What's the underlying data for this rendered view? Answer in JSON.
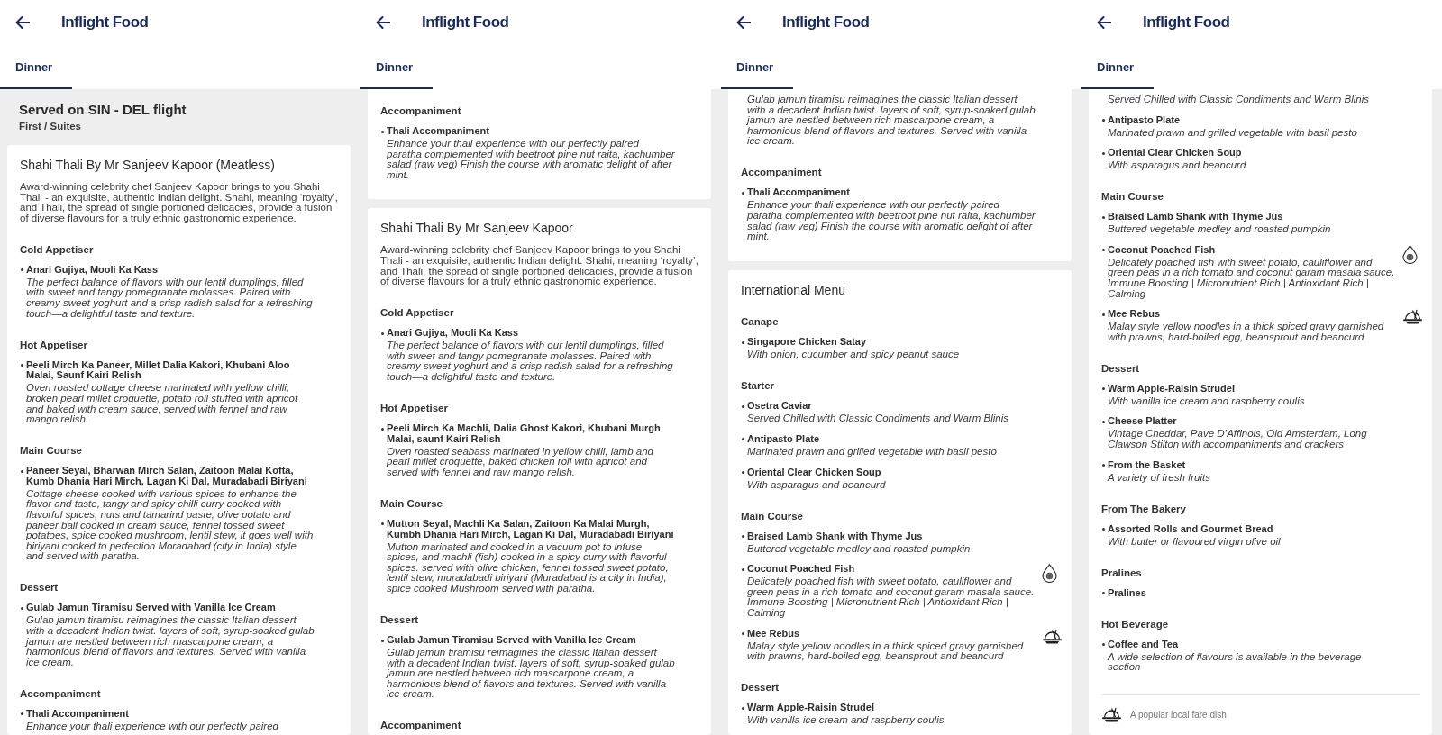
{
  "screens": [
    {
      "header": {
        "title": "Inflight Food"
      },
      "tabs": [
        {
          "label": "Dinner",
          "selected": true
        }
      ],
      "flight": {
        "route": "Served on SIN - DEL flight",
        "cabin": "First / Suites"
      },
      "cards": [
        {
          "title": "Shahi Thali By Mr Sanjeev Kapoor (Meatless)",
          "description": "Award-winning celebrity chef Sanjeev Kapoor brings to you Shahi Thali - an exquisite, authentic Indian delight. Shahi, meaning ‘royalty’, and Thali, the spread of single portioned delicacies, provide a fusion of diverse flavours for a truly ethnic gastronomic experience.",
          "sections": [
            {
              "heading": "Cold Appetiser",
              "items": [
                {
                  "name": "Anari Gujiya, Mooli Ka Kass",
                  "description": "The perfect balance of flavors with our lentil dumplings, filled with sweet and tangy pomegranate molasses. Paired with creamy sweet yoghurt and a crisp radish salad for a refreshing touch—a delightful taste and texture."
                }
              ]
            },
            {
              "heading": "Hot Appetiser",
              "items": [
                {
                  "name": "Peeli Mirch Ka Paneer, Millet Dalia Kakori, Khubani Aloo Malai, Saunf Kairi Relish",
                  "description": "Oven roasted cottage cheese marinated with yellow chilli, broken pearl millet croquette, potato roll stuffed with apricot and baked with cream sauce, served with fennel and raw mango relish."
                }
              ]
            },
            {
              "heading": "Main Course",
              "items": [
                {
                  "name": "Paneer Seyal, Bharwan Mirch Salan, Zaitoon Malai Kofta, Kumb Dhania Hari Mirch, Lagan Ki Dal, Muradabadi Biriyani",
                  "description": "Cottage cheese cooked with various spices to enhance the flavor and taste, tangy and spicy chilli curry cooked with flavorful spices, nuts and tamarind paste, olive potato and paneer ball cooked in cream sauce, fennel tossed sweet potatoes, spice cooked mushroom, lentil stew, it goes well with biriyani cooked to perfection Moradabad (city in India) style and served with paratha."
                }
              ]
            },
            {
              "heading": "Dessert",
              "items": [
                {
                  "name": "Gulab Jamun Tiramisu Served with Vanilla Ice Cream",
                  "description": "Gulab jamun tiramisu reimagines the classic Italian dessert with a decadent Indian twist. layers of soft, syrup-soaked gulab jamun are nestled between rich mascarpone cream, a harmonious blend of flavors and textures. Served with vanilla ice cream."
                }
              ]
            },
            {
              "heading": "Accompaniment",
              "items": [
                {
                  "name": "Thali Accompaniment",
                  "description": "Enhance your thali experience with our perfectly paired"
                }
              ]
            }
          ]
        }
      ]
    },
    {
      "header": {
        "title": "Inflight Food"
      },
      "tabs": [
        {
          "label": "Dinner",
          "selected": true
        }
      ],
      "cards": [
        {
          "sections": [
            {
              "heading": "Accompaniment",
              "items": [
                {
                  "name": "Thali Accompaniment",
                  "description": "Enhance your thali experience with our perfectly paired paratha complemented with beetroot pine nut raita, kachumber salad (raw veg) Finish the course with aromatic delight of after mint."
                }
              ]
            }
          ]
        },
        {
          "title": "Shahi Thali By Mr Sanjeev Kapoor",
          "description": "Award-winning celebrity chef Sanjeev Kapoor brings to you Shahi Thali - an exquisite, authentic Indian delight. Shahi, meaning ‘royalty’, and Thali, the spread of single portioned delicacies, provide a fusion of diverse flavours for a truly ethnic gastronomic experience.",
          "sections": [
            {
              "heading": "Cold Appetiser",
              "items": [
                {
                  "name": "Anari Gujiya, Mooli Ka Kass",
                  "description": "The perfect balance of flavors with our lentil dumplings, filled with sweet and tangy pomegranate molasses. Paired with creamy sweet yoghurt and a crisp radish salad for a refreshing touch—a delightful taste and texture."
                }
              ]
            },
            {
              "heading": "Hot Appetiser",
              "items": [
                {
                  "name": "Peeli Mirch Ka Machli, Dalia Ghost Kakori, Khubani Murgh Malai, saunf Kairi Relish",
                  "description": "Oven roasted seabass marinated in yellow chilli, lamb and pearl millet croquette, baked chicken roll with apricot and served with fennel and raw mango relish."
                }
              ]
            },
            {
              "heading": "Main Course",
              "items": [
                {
                  "name": "Mutton Seyal, Machli Ka Salan, Zaitoon Ka Malai Murgh, Kumbh Dhania Hari Mirch, Lagan Ki Dal, Muradabadi Biriyani",
                  "description": "Mutton marinated and cooked in a vacuum pot to infuse spices, and machli (fish) cooked in a spicy curry with flavorful spices. served with olive chicken, fennel tossed sweet potato, lentil stew, muradabadi biriyani (Muradabad is a city in India), spice cooked Mushroom served with paratha."
                }
              ]
            },
            {
              "heading": "Dessert",
              "items": [
                {
                  "name": "Gulab Jamun Tiramisu Served with Vanilla Ice Cream",
                  "description": "Gulab jamun tiramisu reimagines the classic Italian dessert with a decadent Indian twist. layers of soft, syrup-soaked gulab jamun are nestled between rich mascarpone cream, a harmonious blend of flavors and textures. Served with vanilla ice cream."
                }
              ]
            },
            {
              "heading": "Accompaniment"
            }
          ]
        }
      ]
    },
    {
      "header": {
        "title": "Inflight Food"
      },
      "tabs": [
        {
          "label": "Dinner",
          "selected": true
        }
      ],
      "cards": [
        {
          "sections": [
            {
              "items": [
                {
                  "description": "Gulab jamun tiramisu reimagines the classic Italian dessert with a decadent Indian twist. layers of soft, syrup-soaked gulab jamun are nestled between rich mascarpone cream, a harmonious blend of flavors and textures. Served with vanilla ice cream."
                }
              ]
            },
            {
              "heading": "Accompaniment",
              "items": [
                {
                  "name": "Thali Accompaniment",
                  "description": "Enhance your thali experience with our perfectly paired paratha complemented with beetroot pine nut raita, kachumber salad (raw veg) Finish the course with aromatic delight of after mint."
                }
              ]
            }
          ]
        },
        {
          "title": "International Menu",
          "sections": [
            {
              "heading": "Canape",
              "items": [
                {
                  "name": "Singapore Chicken Satay",
                  "description": "With onion, cucumber and spicy peanut sauce"
                }
              ]
            },
            {
              "heading": "Starter",
              "items": [
                {
                  "name": "Osetra Caviar",
                  "description": "Served Chilled with Classic Condiments and Warm Blinis"
                },
                {
                  "name": "Antipasto Plate",
                  "description": "Marinated prawn and grilled vegetable with basil pesto"
                },
                {
                  "name": "Oriental Clear Chicken Soup",
                  "description": "With asparagus and beancurd"
                }
              ]
            },
            {
              "heading": "Main Course",
              "items": [
                {
                  "name": "Braised Lamb Shank with Thyme Jus",
                  "description": "Buttered vegetable medley and roasted pumpkin"
                },
                {
                  "name": "Coconut Poached Fish",
                  "description": "Delicately poached fish with sweet potato, cauliflower and green peas in a rich tomato and coconut garam masala sauce.",
                  "notes": "Immune Boosting | Micronutrient Rich | Antioxidant Rich | Calming",
                  "wellness": true
                },
                {
                  "name": "Mee Rebus",
                  "description": "Malay style yellow noodles in a thick spiced gravy garnished with prawns, hard-boiled egg, beansprout and beancurd",
                  "local_fare": true
                }
              ]
            },
            {
              "heading": "Dessert",
              "items": [
                {
                  "name": "Warm Apple-Raisin Strudel",
                  "description": "With vanilla ice cream and raspberry coulis"
                }
              ]
            }
          ]
        }
      ]
    },
    {
      "header": {
        "title": "Inflight Food"
      },
      "tabs": [
        {
          "label": "Dinner",
          "selected": true
        }
      ],
      "cards": [
        {
          "sections": [
            {
              "items": [
                {
                  "description": "Served Chilled with Classic Condiments and Warm Blinis"
                },
                {
                  "name": "Antipasto Plate",
                  "description": "Marinated prawn and grilled vegetable with basil pesto"
                },
                {
                  "name": "Oriental Clear Chicken Soup",
                  "description": "With asparagus and beancurd"
                }
              ]
            },
            {
              "heading": "Main Course",
              "items": [
                {
                  "name": "Braised Lamb Shank with Thyme Jus",
                  "description": "Buttered vegetable medley and roasted pumpkin"
                },
                {
                  "name": "Coconut Poached Fish",
                  "description": "Delicately poached fish with sweet potato, cauliflower and green peas in a rich tomato and coconut garam masala sauce.",
                  "notes": "Immune Boosting | Micronutrient Rich | Antioxidant Rich | Calming",
                  "wellness": true
                },
                {
                  "name": "Mee Rebus",
                  "description": "Malay style yellow noodles in a thick spiced gravy garnished with prawns, hard-boiled egg, beansprout and beancurd",
                  "local_fare": true
                }
              ]
            },
            {
              "heading": "Dessert",
              "items": [
                {
                  "name": "Warm Apple-Raisin Strudel",
                  "description": "With vanilla ice cream and raspberry coulis"
                },
                {
                  "name": "Cheese Platter",
                  "description": "Vintage Cheddar, Pave D’Affinois, Old Amsterdam, Long Clawson Stilton with accompaniments and crackers"
                },
                {
                  "name": "From the Basket",
                  "description": "A variety of fresh fruits"
                }
              ]
            },
            {
              "heading": "From The Bakery",
              "items": [
                {
                  "name": "Assorted Rolls and Gourmet Bread",
                  "description": "With butter or flavoured virgin olive oil"
                }
              ]
            },
            {
              "heading": "Pralines",
              "items": [
                {
                  "name": "Pralines"
                }
              ]
            },
            {
              "heading": "Hot Beverage",
              "items": [
                {
                  "name": "Coffee and Tea",
                  "description": "A wide selection of flavours is available in the beverage section"
                }
              ]
            }
          ],
          "legend": [
            {
              "text": "A popular local fare dish"
            }
          ]
        }
      ]
    }
  ]
}
